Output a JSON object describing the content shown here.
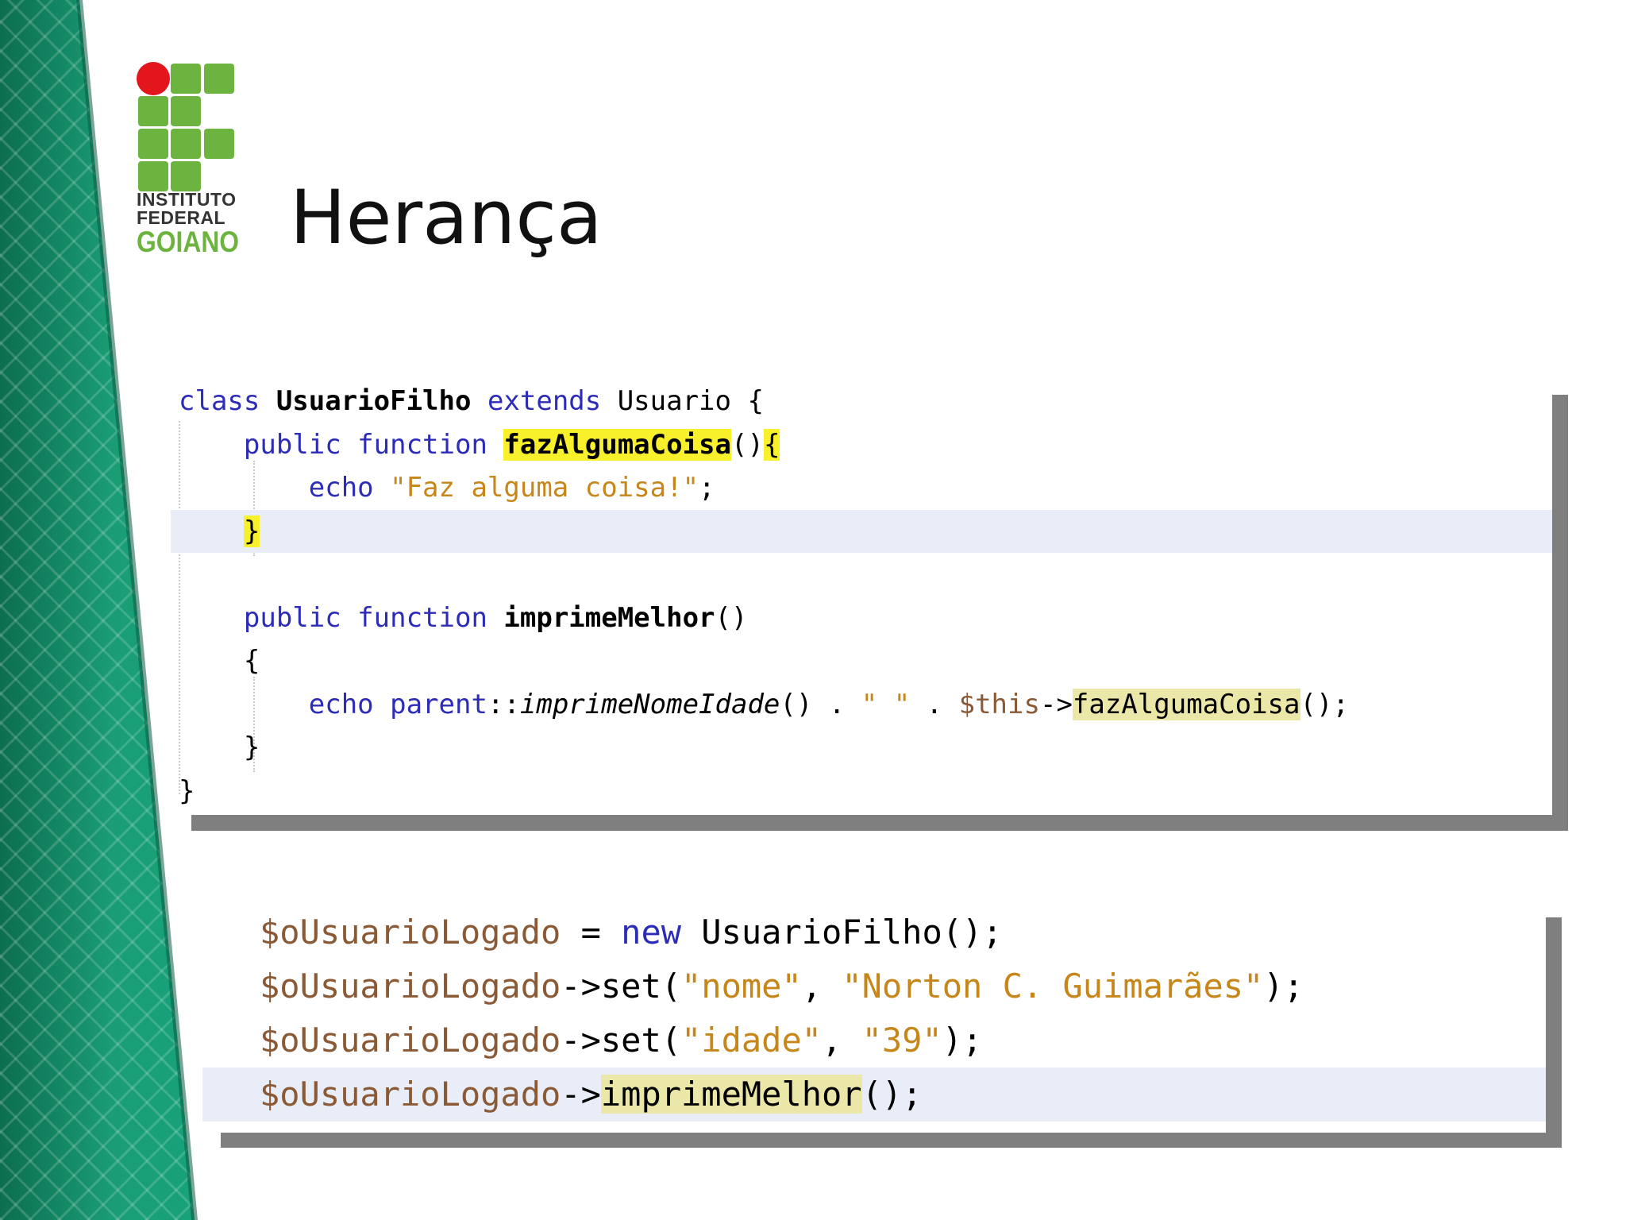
{
  "logo": {
    "line1": "INSTITUTO",
    "line2": "FEDERAL",
    "line3": "GOIANO",
    "colors": {
      "green": "#6cb33f",
      "red": "#e3161d"
    }
  },
  "slide": {
    "title": "Herança"
  },
  "code_block_1": {
    "lines": [
      [
        {
          "t": "class ",
          "c": "kw"
        },
        {
          "t": "UsuarioFilho",
          "c": "bold"
        },
        {
          "t": " extends ",
          "c": "kw"
        },
        {
          "t": "Usuario {",
          "c": "plain"
        }
      ],
      [
        {
          "t": "    public function ",
          "c": "kw"
        },
        {
          "t": "fazAlgumaCoisa",
          "c": "bold",
          "hl": "yellow"
        },
        {
          "t": "()",
          "c": "plain"
        },
        {
          "t": "{",
          "c": "plain",
          "hl": "yellow"
        }
      ],
      [
        {
          "t": "        echo ",
          "c": "kw"
        },
        {
          "t": "\"Faz alguma coisa!\"",
          "c": "str"
        },
        {
          "t": ";",
          "c": "plain"
        }
      ],
      [
        {
          "t": "    ",
          "c": "plain"
        },
        {
          "t": "}",
          "c": "plain",
          "hl": "yellow"
        }
      ],
      [
        {
          "t": "",
          "c": "plain"
        }
      ],
      [
        {
          "t": "    public function ",
          "c": "kw"
        },
        {
          "t": "imprimeMelhor",
          "c": "bold"
        },
        {
          "t": "()",
          "c": "plain"
        }
      ],
      [
        {
          "t": "    {",
          "c": "plain"
        }
      ],
      [
        {
          "t": "        echo parent",
          "c": "kw"
        },
        {
          "t": "::",
          "c": "plain"
        },
        {
          "t": "imprimeNomeIdade",
          "c": "it"
        },
        {
          "t": "() . ",
          "c": "plain"
        },
        {
          "t": "\" \"",
          "c": "str"
        },
        {
          "t": " . ",
          "c": "plain"
        },
        {
          "t": "$this",
          "c": "var"
        },
        {
          "t": "->",
          "c": "plain"
        },
        {
          "t": "fazAlgumaCoisa",
          "c": "fn",
          "hl": "khaki"
        },
        {
          "t": "();",
          "c": "plain"
        }
      ],
      [
        {
          "t": "    }",
          "c": "plain"
        }
      ],
      [
        {
          "t": "}",
          "c": "plain"
        }
      ]
    ],
    "highlighted_line": 3
  },
  "code_block_2": {
    "lines": [
      [
        {
          "t": "$oUsuarioLogado",
          "c": "var"
        },
        {
          "t": " = ",
          "c": "plain"
        },
        {
          "t": "new",
          "c": "kw"
        },
        {
          "t": " UsuarioFilho();",
          "c": "plain"
        }
      ],
      [
        {
          "t": "$oUsuarioLogado",
          "c": "var"
        },
        {
          "t": "->set(",
          "c": "plain"
        },
        {
          "t": "\"nome\"",
          "c": "str"
        },
        {
          "t": ", ",
          "c": "plain"
        },
        {
          "t": "\"Norton C. Guimarães\"",
          "c": "str"
        },
        {
          "t": ");",
          "c": "plain"
        }
      ],
      [
        {
          "t": "$oUsuarioLogado",
          "c": "var"
        },
        {
          "t": "->set(",
          "c": "plain"
        },
        {
          "t": "\"idade\"",
          "c": "str"
        },
        {
          "t": ", ",
          "c": "plain"
        },
        {
          "t": "\"39\"",
          "c": "str"
        },
        {
          "t": ");",
          "c": "plain"
        }
      ],
      [
        {
          "t": "$oUsuarioLogado",
          "c": "var"
        },
        {
          "t": "->",
          "c": "plain"
        },
        {
          "t": "imprimeMelhor",
          "c": "fn",
          "hl": "khaki"
        },
        {
          "t": "();",
          "c": "plain"
        }
      ]
    ],
    "highlighted_line": 3
  },
  "colors": {
    "keyword": "#2c2cb8",
    "string": "#c6861a",
    "variable": "#8a5a36",
    "highlight_yellow": "#f8f02a",
    "highlight_khaki": "#ebe7a8",
    "current_line": "#e8edf7",
    "band_green": "#14946b"
  }
}
